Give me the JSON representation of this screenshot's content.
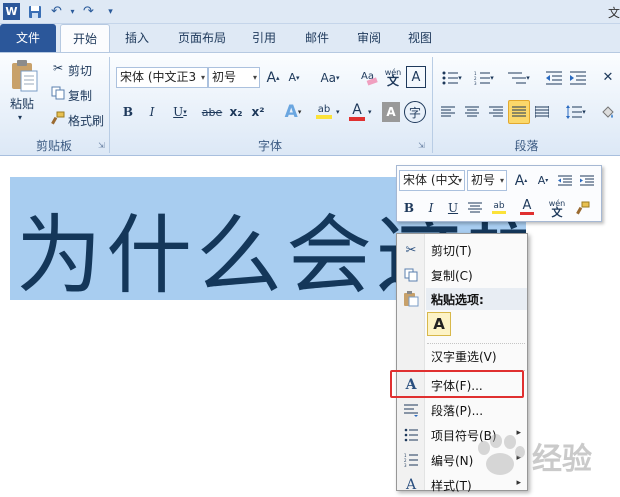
{
  "qat": {
    "app_icon": "word-icon",
    "save_icon": "save-icon",
    "undo_icon": "undo-icon",
    "redo_icon": "redo-icon",
    "customize_icon": "qat-customize-icon",
    "title_fragment": "文"
  },
  "tabs": [
    "文件",
    "开始",
    "插入",
    "页面布局",
    "引用",
    "邮件",
    "审阅",
    "视图"
  ],
  "ribbon": {
    "clipboard": {
      "paste": "粘贴",
      "cut": "剪切",
      "copy": "复制",
      "format_painter": "格式刷",
      "group_label": "剪贴板"
    },
    "font": {
      "font_name": "宋体 (中文正3",
      "font_size": "初号",
      "group_label": "字体",
      "bold": "B",
      "italic": "I",
      "underline": "U",
      "strike": "abe",
      "subscript": "x₂",
      "superscript": "x²",
      "change_case": "Aa",
      "clear": "A",
      "phonetic": "wén",
      "border_char": "A",
      "grow": "A",
      "shrink": "A",
      "highlight": "ab",
      "color": "A",
      "shading": "A",
      "enclose": "字"
    },
    "paragraph": {
      "group_label": "段落"
    },
    "accent_red": "#e03030",
    "highlight_yellow": "#fbd86a"
  },
  "document": {
    "selected_text": "为什么会这样"
  },
  "mini_toolbar": {
    "font_name": "宋体 (中文",
    "font_size": "初号",
    "bold": "B",
    "italic": "I",
    "underline": "U",
    "color": "A",
    "phonetic": "wén"
  },
  "context_menu": {
    "items": [
      {
        "label": "剪切(T)",
        "icon": "scissors-icon"
      },
      {
        "label": "复制(C)",
        "icon": "copy-icon"
      },
      {
        "label": "粘贴选项:",
        "icon": "paste-icon"
      },
      {
        "label": "A",
        "icon": "paste-keep-text-icon"
      },
      {
        "label": "汉字重选(V)",
        "icon": ""
      },
      {
        "label": "字体(F)...",
        "icon": "font-icon"
      },
      {
        "label": "段落(P)...",
        "icon": "paragraph-icon"
      },
      {
        "label": "项目符号(B)",
        "icon": "bullets-icon"
      },
      {
        "label": "编号(N)",
        "icon": "numbering-icon"
      },
      {
        "label": "样式(T)",
        "icon": "styles-icon"
      }
    ],
    "highlighted_item": "字体(F)..."
  },
  "watermark": {
    "text": "经验"
  }
}
